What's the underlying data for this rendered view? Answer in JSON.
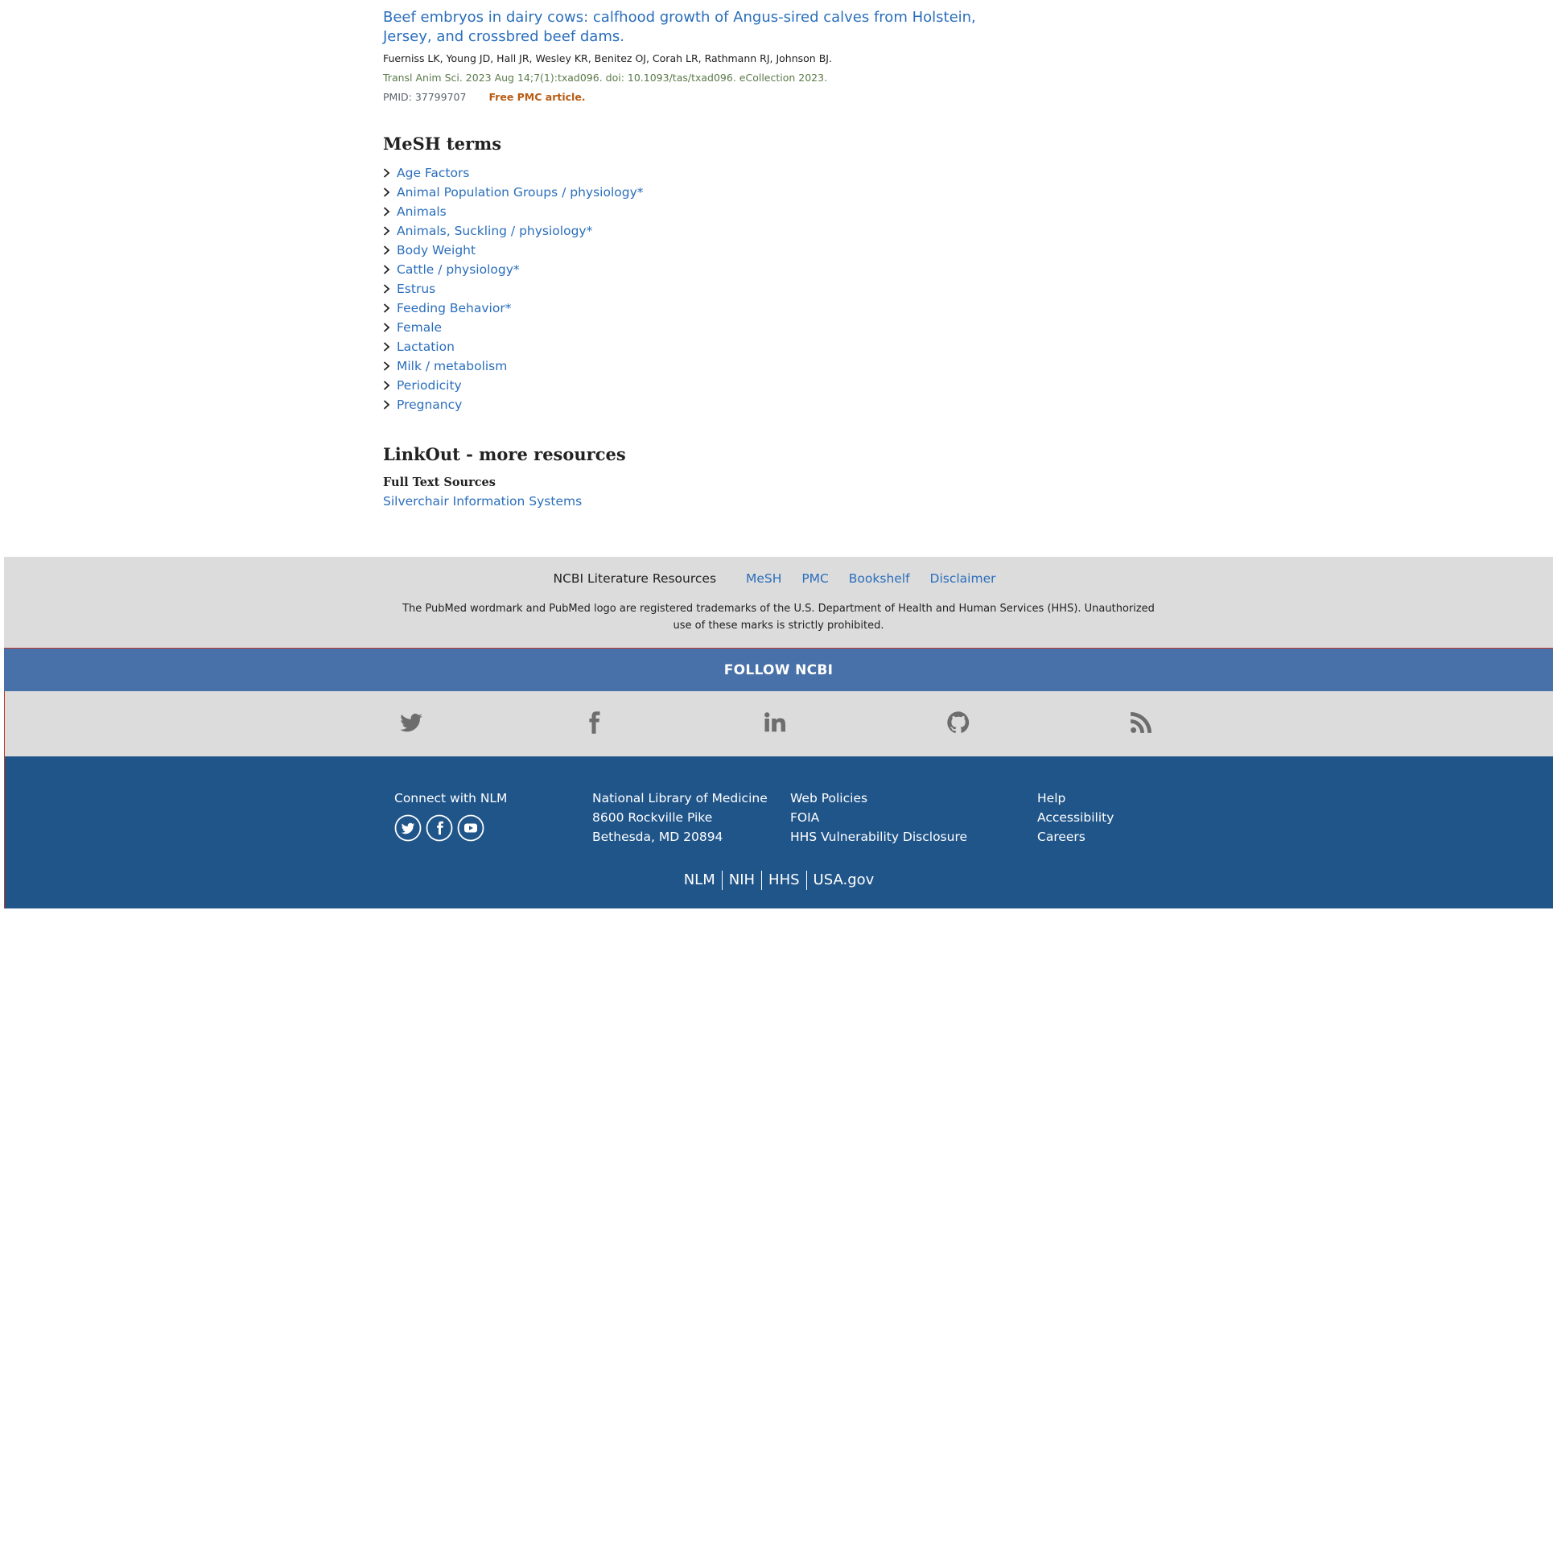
{
  "article": {
    "title": "Beef embryos in dairy cows: calfhood growth of Angus-sired calves from Holstein, Jersey, and crossbred beef dams.",
    "authors": "Fuerniss LK, Young JD, Hall JR, Wesley KR, Benitez OJ, Corah LR, Rathmann RJ, Johnson BJ.",
    "citation": "Transl Anim Sci. 2023 Aug 14;7(1):txad096. doi: 10.1093/tas/txad096. eCollection 2023.",
    "pmid": "PMID: 37799707",
    "free_pmc": "Free PMC article."
  },
  "mesh": {
    "heading": "MeSH terms",
    "terms": [
      "Age Factors",
      "Animal Population Groups / physiology*",
      "Animals",
      "Animals, Suckling / physiology*",
      "Body Weight",
      "Cattle / physiology*",
      "Estrus",
      "Feeding Behavior*",
      "Female",
      "Lactation",
      "Milk / metabolism",
      "Periodicity",
      "Pregnancy"
    ]
  },
  "linkout": {
    "heading": "LinkOut - more resources",
    "subheading": "Full Text Sources",
    "link": "Silverchair Information Systems"
  },
  "literature_footer": {
    "label": "NCBI Literature Resources",
    "links": [
      "MeSH",
      "PMC",
      "Bookshelf",
      "Disclaimer"
    ],
    "notice": "The PubMed wordmark and PubMed logo are registered trademarks of the U.S. Department of Health and Human Services (HHS). Unauthorized use of these marks is strictly prohibited."
  },
  "follow": {
    "label": "FOLLOW NCBI",
    "icons": [
      "twitter-icon",
      "facebook-icon",
      "linkedin-icon",
      "github-icon",
      "rss-icon"
    ]
  },
  "nlm_footer": {
    "connect_label": "Connect with NLM",
    "address": [
      "National Library of Medicine",
      "8600 Rockville Pike",
      "Bethesda, MD 20894"
    ],
    "policies": [
      "Web Policies",
      "FOIA",
      "HHS Vulnerability Disclosure"
    ],
    "help": [
      "Help",
      "Accessibility",
      "Careers"
    ],
    "gov_links": [
      "NLM",
      "NIH",
      "HHS",
      "USA.gov"
    ]
  },
  "colors": {
    "link": "#2a6ebb",
    "footer_gray": "#dcdcdc",
    "follow_bar": "#4871a9",
    "nlm_blue": "#20558a",
    "free_pmc": "#b85c13"
  }
}
